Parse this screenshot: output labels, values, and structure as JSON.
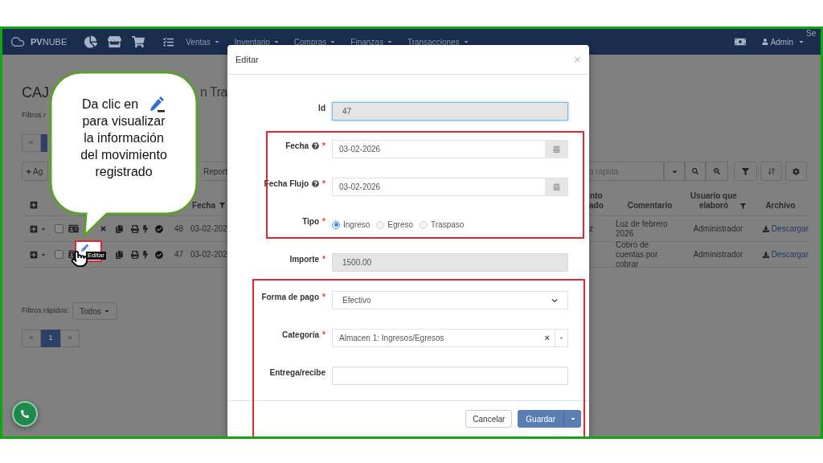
{
  "corner_text": "Se",
  "navbar": {
    "brand": "**PV**NUBE",
    "menus": [
      "Ventas",
      "Inventario",
      "Compras",
      "Finanzas",
      "Transacciones"
    ],
    "user": "Admin"
  },
  "page": {
    "title": "CAJ",
    "title_tail": "n Tra",
    "filters_label": "Filtros r",
    "top_pager": [
      {
        "label": "«",
        "selected": false
      },
      {
        "selected": true
      }
    ],
    "add_button": "Ag",
    "report_button": "Report",
    "search_placeholder": "a rápida",
    "table": {
      "left_header": {
        "label": "Fecha",
        "filter": true
      },
      "right_headers": [
        {
          "lines": [
            "nto",
            "ado"
          ],
          "filter": false
        },
        {
          "lines": [
            "Comentario"
          ],
          "filter": false
        },
        {
          "lines": [
            "Usuario que",
            "elaboró"
          ],
          "filter": true
        },
        {
          "lines": [
            "Archivo"
          ],
          "filter": false
        }
      ],
      "rows": [
        {
          "id": "48",
          "date": "03-02-202",
          "checked": false,
          "highlighted": false,
          "col_1": "z",
          "comment": "Luz de febrero 2026",
          "user": "Administrador",
          "file": "Descargar"
        },
        {
          "id": "47",
          "date": "03-02-202",
          "checked": false,
          "highlighted": true,
          "tooltip": "Editar",
          "comment": "Cobro de cuentas por cobrar",
          "user": "Administrador",
          "file": "Descargar"
        }
      ]
    },
    "quick_filters": {
      "label": "Filtros rápidos:",
      "value": "Todos"
    },
    "pager": [
      {
        "label": "«",
        "selected": false
      },
      {
        "label": "1",
        "selected": true
      },
      {
        "label": "»",
        "selected": false
      }
    ]
  },
  "modal": {
    "title": "Editar",
    "close": "×",
    "fields": [
      {
        "kind": "text",
        "label": "Id",
        "value": "47",
        "readonly": true,
        "focused": true
      },
      {
        "kind": "date",
        "label": "Fecha",
        "help": true,
        "mark": "*",
        "value": "03-02-2026"
      },
      {
        "kind": "date",
        "label": "Fecha Flujo",
        "help": true,
        "mark": "*",
        "value": "03-02-2026"
      },
      {
        "kind": "radio",
        "label": "Tipo",
        "mark": "*",
        "options": [
          {
            "label": "Ingreso",
            "selected": true
          },
          {
            "label": "Egreso",
            "selected": false
          },
          {
            "label": "Traspaso",
            "selected": false
          }
        ]
      },
      {
        "kind": "text",
        "label": "Importe",
        "mark": "*",
        "value": "1500.00",
        "readonly": true,
        "focused": false
      },
      {
        "kind": "select",
        "label": "Forma de pago",
        "mark": "*",
        "value": "Efectivo"
      },
      {
        "kind": "combo",
        "label": "Categoría",
        "mark": "*",
        "value": "Almacen 1: Ingresos/Egresos",
        "clear": "×"
      },
      {
        "kind": "text",
        "label": "Entrega/recibe",
        "readonly": false,
        "focused": false
      }
    ],
    "cancel": "Cancelar",
    "save": "Guardar"
  },
  "callout": {
    "before": "Da clic en",
    "after": "para visualizar la información del movimiento registrado"
  }
}
